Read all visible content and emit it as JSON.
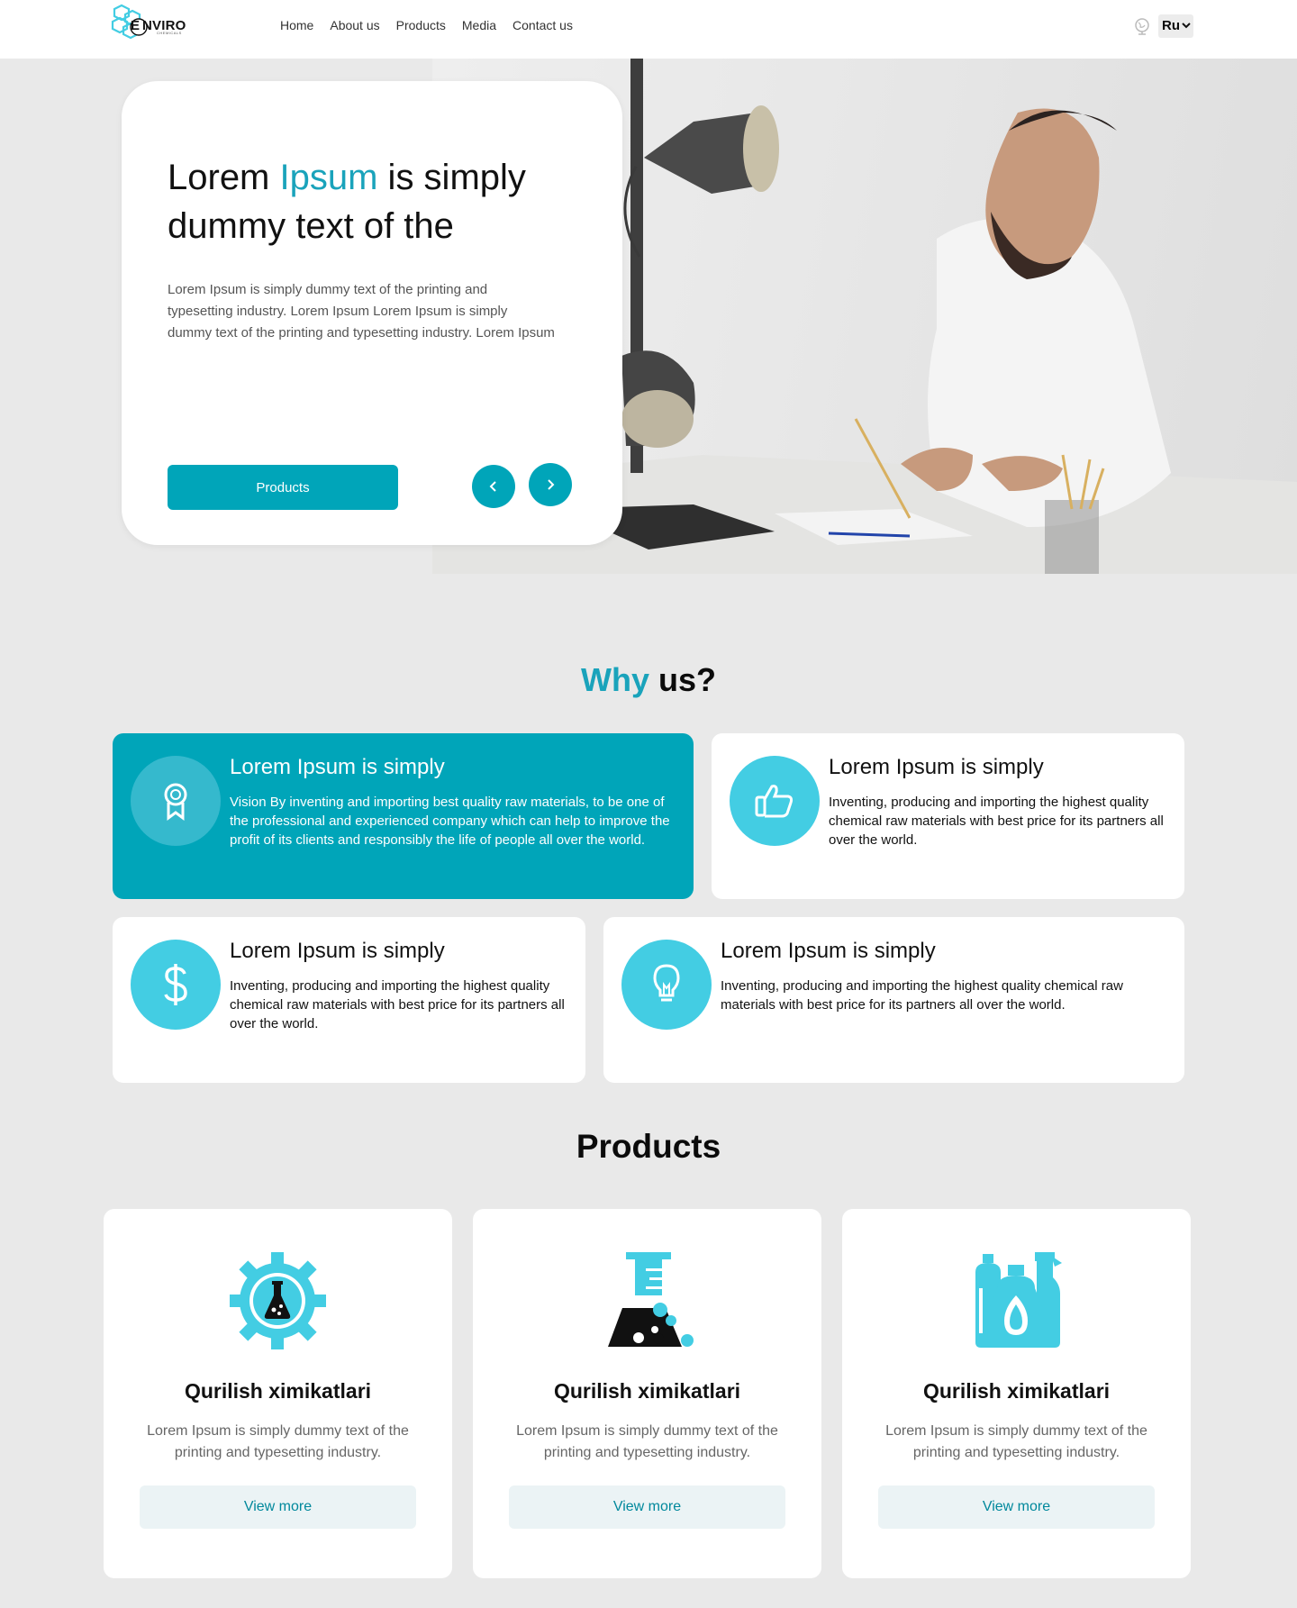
{
  "brand": {
    "name": "NVIRO",
    "logo_letter": "E",
    "tagline": "CHEMICALS",
    "accent_color": "#00a5b9",
    "icon_color": "#43cde3"
  },
  "nav": {
    "items": [
      "Home",
      "About us",
      "Products",
      "Media",
      "Contact us"
    ]
  },
  "language": {
    "icon": "globe-icon",
    "selected": "Ru"
  },
  "hero": {
    "title_part1": "Lorem ",
    "title_accent": "Ipsum",
    "title_part2": " is simply dummy text of the",
    "text": "Lorem Ipsum is simply dummy text of the printing and typesetting industry. Lorem Ipsum Lorem Ipsum is simply dummy text of the printing and typesetting industry. Lorem Ipsum",
    "button_label": "Products",
    "prev_icon": "chevron-left-icon",
    "next_icon": "chevron-right-icon"
  },
  "why": {
    "title_accent": "Why",
    "title_rest": " us?",
    "features": [
      {
        "icon": "award-icon",
        "title": "Lorem Ipsum is simply",
        "text": "Vision By inventing and importing best quality raw materials, to be one of the professional and experienced company which can help to improve the profit of its clients and responsibly the life of people all over the world."
      },
      {
        "icon": "thumbs-up-icon",
        "title": "Lorem Ipsum is simply",
        "text": "Inventing, producing and importing the highest quality chemical raw materials with best price for its partners all over the world."
      },
      {
        "icon": "dollar-icon",
        "title": "Lorem Ipsum is simply",
        "text": "Inventing, producing and importing the highest quality chemical raw materials with best price for its partners all over the world."
      },
      {
        "icon": "lightbulb-icon",
        "title": "Lorem Ipsum is simply",
        "text": "Inventing, producing and importing the highest quality chemical raw materials with best price for its partners all over the world."
      }
    ]
  },
  "products": {
    "title": "Products",
    "items": [
      {
        "icon": "chemistry-gear-icon",
        "title": "Qurilish ximikatlari",
        "text": "Lorem Ipsum is simply dummy text of the printing and typesetting industry.",
        "button": "View more"
      },
      {
        "icon": "lab-flask-icon",
        "title": "Qurilish ximikatlari",
        "text": "Lorem Ipsum is simply dummy text of the printing and typesetting industry.",
        "button": "View more"
      },
      {
        "icon": "cleaning-bottles-icon",
        "title": "Qurilish ximikatlari",
        "text": "Lorem Ipsum is simply dummy text of the printing and typesetting industry.",
        "button": "View more"
      }
    ]
  }
}
